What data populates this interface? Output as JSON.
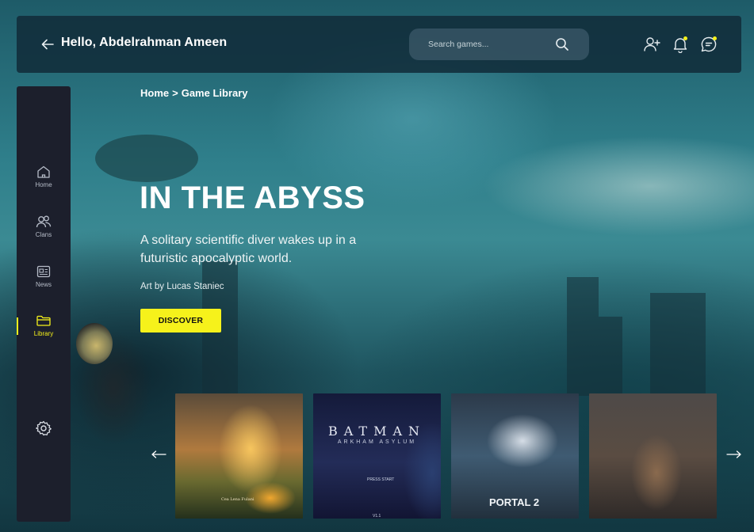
{
  "header": {
    "greeting": "Hello, Abdelrahman Ameen",
    "back_icon": "arrow-left-icon",
    "search": {
      "placeholder": "Search games...",
      "icon": "search-icon"
    },
    "icons": [
      "add-friend-icon",
      "bell-icon",
      "chat-icon"
    ],
    "notification_dot_color": "#f6f21b"
  },
  "sidebar": {
    "items": [
      {
        "label": "Home",
        "icon": "home-icon",
        "active": false
      },
      {
        "label": "Clans",
        "icon": "users-icon",
        "active": false
      },
      {
        "label": "News",
        "icon": "news-icon",
        "active": false
      },
      {
        "label": "Library",
        "icon": "folder-icon",
        "active": true
      }
    ],
    "settings_icon": "gear-icon",
    "accent_color": "#f6f21b"
  },
  "breadcrumb": {
    "items": [
      "Home",
      "Game Library"
    ],
    "separator": ">"
  },
  "hero": {
    "title": "IN THE ABYSS",
    "description": "A solitary scientific diver wakes up in a futuristic apocalyptic world.",
    "credit": "Art by Lucas Staniec",
    "cta_label": "DISCOVER",
    "cta_color": "#f6f21b"
  },
  "carousel": {
    "prev_icon": "arrow-left-long-icon",
    "next_icon": "arrow-right-long-icon",
    "cards": [
      {
        "art_text": "Cea Lena Fulani"
      },
      {
        "art_title": "BATMAN",
        "art_subtitle": "ARKHAM ASYLUM",
        "art_prompt": "PRESS START",
        "art_version": "V1.1"
      },
      {
        "art_title": "PORTAL 2"
      },
      {
        "art_text": ""
      }
    ]
  }
}
